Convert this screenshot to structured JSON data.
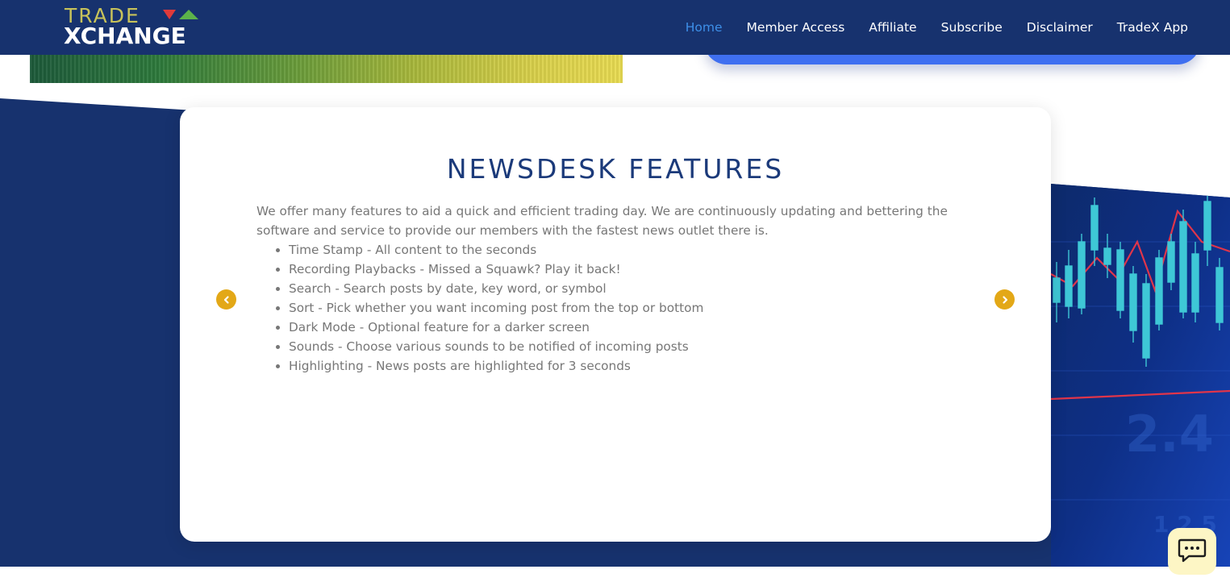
{
  "header": {
    "logo": {
      "line1": "TRADE",
      "line2": "XCHANGE"
    },
    "nav": [
      {
        "label": "Home",
        "active": true
      },
      {
        "label": "Member Access",
        "active": false
      },
      {
        "label": "Affiliate",
        "active": false
      },
      {
        "label": "Subscribe",
        "active": false
      },
      {
        "label": "Disclaimer",
        "active": false
      },
      {
        "label": "TradeX App",
        "active": false
      }
    ]
  },
  "features": {
    "title": "NEWSDESK FEATURES",
    "intro": "We offer many features to aid a quick and efficient trading day. We are continuously updating and bettering the software and service to provide our members with the fastest news outlet there is.",
    "items": [
      "Time Stamp - All content to the seconds",
      "Recording Playbacks - Missed a Squawk? Play it back!",
      "Search - Search posts by date, key word, or symbol",
      "Sort - Pick whether you want incoming post from the top or bottom",
      "Dark Mode - Optional feature for a darker screen",
      "Sounds - Choose various sounds to be notified of incoming posts",
      "Highlighting - News posts are highlighted for 3 seconds"
    ]
  },
  "icons": {
    "prev": "chevron-left-icon",
    "next": "chevron-right-icon",
    "chat": "chat-bubble-icon"
  },
  "colors": {
    "brand_navy": "#17326e",
    "nav_active": "#3d8fe8",
    "accent_gold": "#e3a817",
    "logo_gold": "#c7c25a",
    "title_navy": "#1b3a7a",
    "button_blue": "#3f6ff0",
    "chat_bg": "#fdf6c5"
  }
}
